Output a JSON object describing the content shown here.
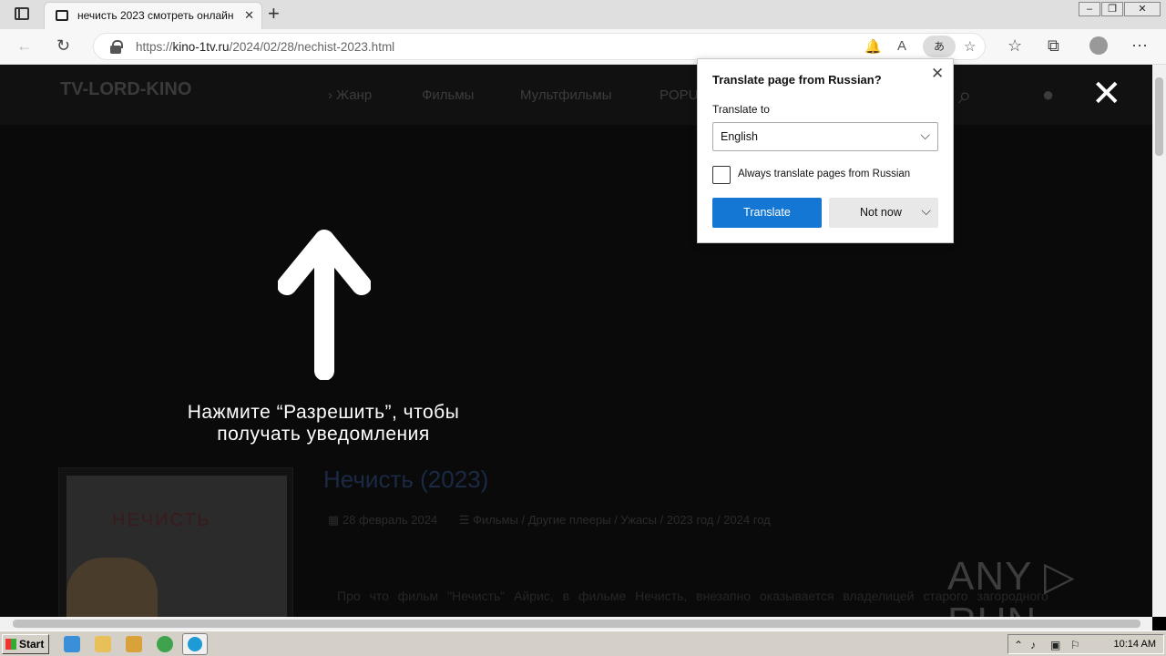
{
  "browser": {
    "tab_title": "нечисть 2023 смотреть онлайн",
    "tab_close": "✕",
    "new_tab": "+",
    "url_prefix": "https://",
    "url_host": "kino-1tv.ru",
    "url_path": "/2024/02/28/nechist-2023.html",
    "translate_icon": "あ"
  },
  "site": {
    "logo": "TV-LORD-KINO",
    "nav": [
      "Жанр",
      "Фильмы",
      "Мультфильмы",
      "POPU"
    ],
    "notification_prompt": "Нажмите “Разрешить”, чтобы получать уведомления",
    "overlay_close": "✕",
    "poster_title": "НЕЧИСТЬ",
    "movie_title": "Нечисть (2023)",
    "date": "28 февраль 2024",
    "categories": "Фильмы / Другие плееры / Ужасы / 2023 год / 2024 год",
    "description": "Про что фильм \"Нечисть\" Айрис, в фильме Нечисть, внезапно оказывается владелицей старого загородного",
    "watermark": "ANY ▷ RUN"
  },
  "translate_popup": {
    "heading": "Translate page from Russian?",
    "translate_to_label": "Translate to",
    "selected_language": "English",
    "always_label": "Always translate pages from Russian",
    "always_checked": false,
    "translate_button": "Translate",
    "not_now_button": "Not now"
  },
  "taskbar": {
    "start": "Start",
    "clock": "10:14 AM"
  },
  "colors": {
    "accent": "#1477d4",
    "page_bg": "#0a0a0a"
  }
}
